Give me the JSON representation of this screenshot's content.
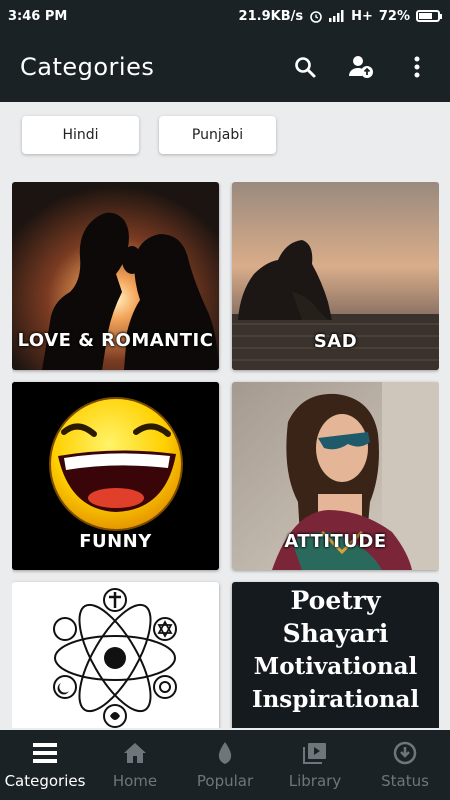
{
  "status_bar": {
    "time": "3:46 PM",
    "speed": "21.9KB/s",
    "network": "H+",
    "battery": "72%",
    "battery_level": 0.72
  },
  "app_bar": {
    "title": "Categories",
    "icons": [
      "search-icon",
      "account-upload-icon",
      "more-vert-icon"
    ]
  },
  "chips": [
    {
      "label": "Hindi"
    },
    {
      "label": "Punjabi"
    }
  ],
  "categories": [
    {
      "label": "LOVE & ROMANTIC"
    },
    {
      "label": "SAD"
    },
    {
      "label": "FUNNY"
    },
    {
      "label": "ATTITUDE"
    },
    {
      "label": ""
    },
    {
      "lines": [
        "Poetry",
        "Shayari",
        "Motivational",
        "Inspirational"
      ]
    }
  ],
  "bottom_nav": [
    {
      "label": "Categories",
      "icon": "categories-icon",
      "active": true
    },
    {
      "label": "Home",
      "icon": "home-icon",
      "active": false
    },
    {
      "label": "Popular",
      "icon": "flame-icon",
      "active": false
    },
    {
      "label": "Library",
      "icon": "library-icon",
      "active": false
    },
    {
      "label": "Status",
      "icon": "download-icon",
      "active": false
    }
  ],
  "colors": {
    "bar": "#1b2226",
    "background": "#ebeced",
    "nav_inactive": "#6e767b",
    "nav_active": "#ffffff"
  }
}
